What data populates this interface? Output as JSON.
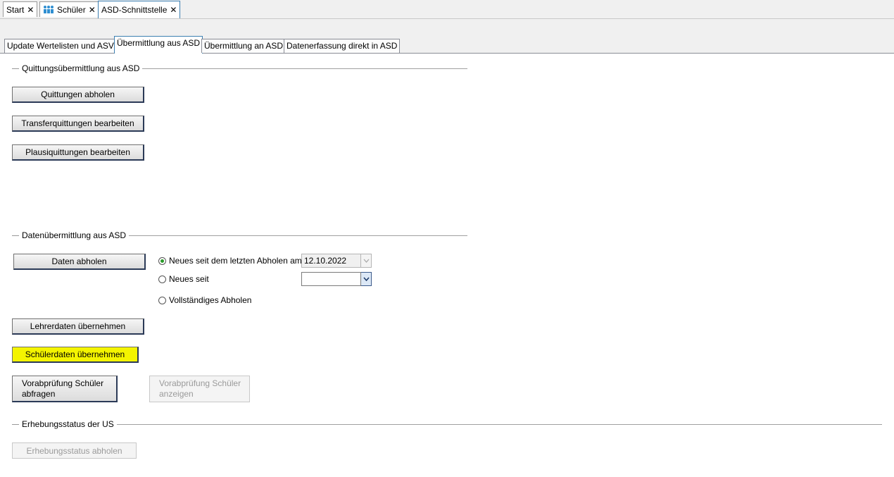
{
  "doc_tabs": [
    {
      "label": "Start"
    },
    {
      "label": "Schüler"
    },
    {
      "label": "ASD-Schnittstelle"
    }
  ],
  "inner_tabs": [
    {
      "label": "Update Wertelisten und ASV"
    },
    {
      "label": "Übermittlung aus ASD"
    },
    {
      "label": "Übermittlung an ASD"
    },
    {
      "label": "Datenerfassung direkt in ASD"
    }
  ],
  "quittung_section": {
    "title": "Quittungsübermittlung aus ASD",
    "buttons": [
      "Quittungen abholen",
      "Transferquittungen bearbeiten",
      "Plausiquittungen bearbeiten"
    ]
  },
  "daten_section": {
    "title": "Datenübermittlung aus ASD",
    "fetch_button": "Daten abholen",
    "radio_options": [
      {
        "label": "Neues seit dem letzten Abholen am",
        "checked": true
      },
      {
        "label": "Neues seit",
        "checked": false
      },
      {
        "label": "Vollständiges Abholen",
        "checked": false
      }
    ],
    "last_fetch_date": "12.10.2022",
    "since_date": "",
    "lehrer_button": "Lehrerdaten übernehmen",
    "schueler_button": "Schülerdaten übernehmen",
    "vorab_query_button": "Vorabprüfung Schüler abfragen",
    "vorab_show_button": "Vorabprüfung Schüler anzeigen",
    "highlight_color": "#f4f400"
  },
  "erhebung_section": {
    "title": "Erhebungsstatus der US",
    "button": "Erhebungsstatus abholen"
  }
}
